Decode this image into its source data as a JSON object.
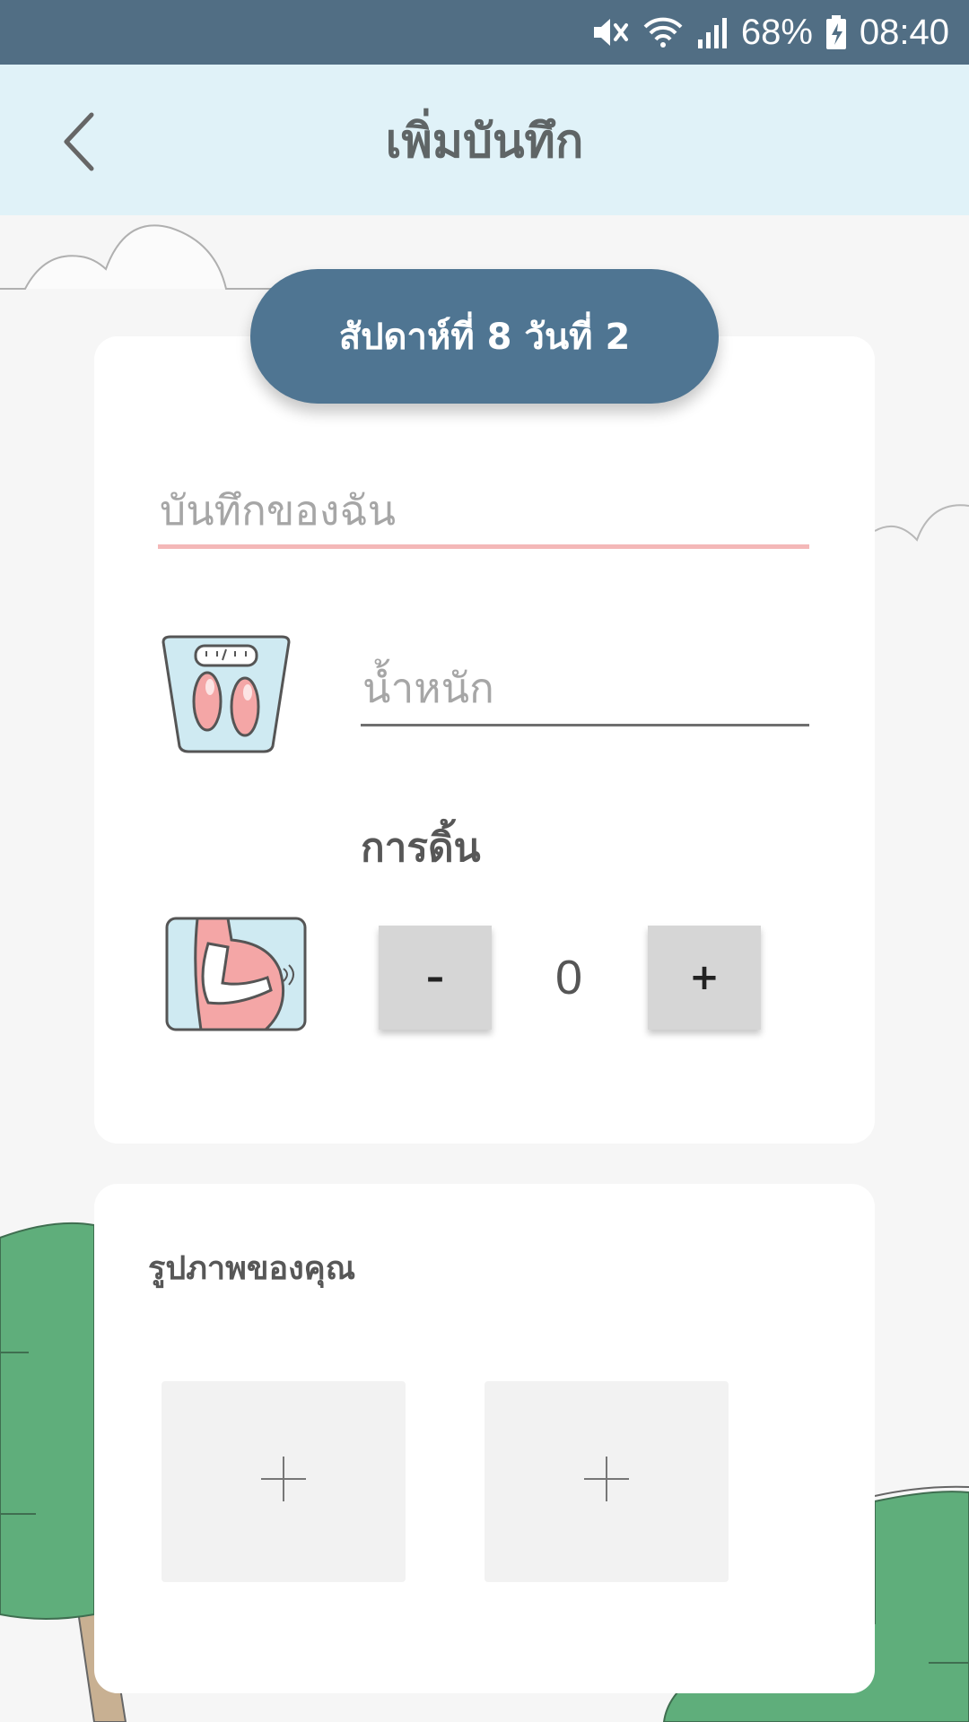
{
  "status_bar": {
    "battery": "68%",
    "time": "08:40",
    "icons": [
      "mute-icon",
      "wifi-icon",
      "signal-icon",
      "battery-charging-icon"
    ]
  },
  "header": {
    "title": "เพิ่มบันทึก",
    "back_icon": "chevron-left-icon"
  },
  "week_badge": "สัปดาห์ที่ 8 วันที่ 2",
  "note": {
    "placeholder": "บันทึกของฉัน",
    "value": "",
    "underline_color": "#f4b8b8"
  },
  "weight": {
    "icon": "scale-icon",
    "placeholder": "น้ำหนัก",
    "value": ""
  },
  "kick": {
    "label": "การดิ้น",
    "icon": "pregnant-belly-icon",
    "minus_label": "–",
    "plus_label": "+",
    "count": "0"
  },
  "photos": {
    "label": "รูปภาพของคุณ",
    "slots": [
      {
        "icon": "plus-icon"
      },
      {
        "icon": "plus-icon"
      }
    ]
  },
  "colors": {
    "status_bar": "#516e84",
    "header_bg": "#e0f2f8",
    "accent": "#4f7592",
    "tree_green": "#5fae7b"
  }
}
